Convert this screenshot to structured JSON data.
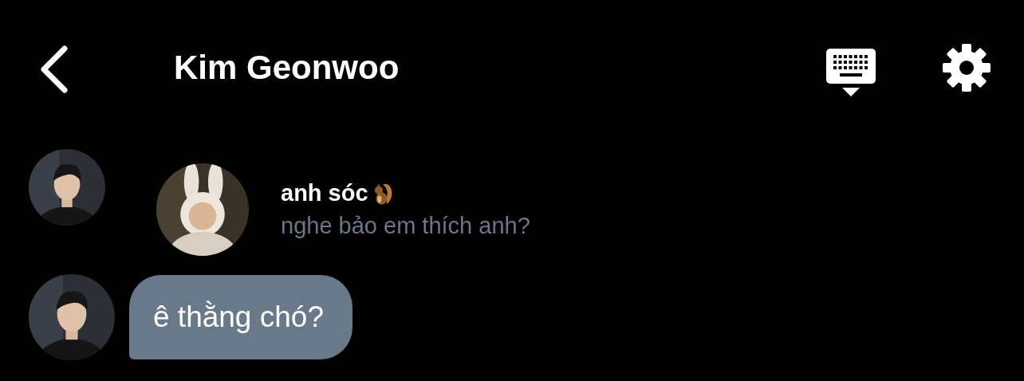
{
  "header": {
    "title": "Kim Geonwoo"
  },
  "messages": [
    {
      "kind": "reply",
      "name": "anh sóc",
      "text": "nghe bảo em thích anh?"
    },
    {
      "kind": "bubble",
      "text": "ê thằng chó?"
    }
  ]
}
